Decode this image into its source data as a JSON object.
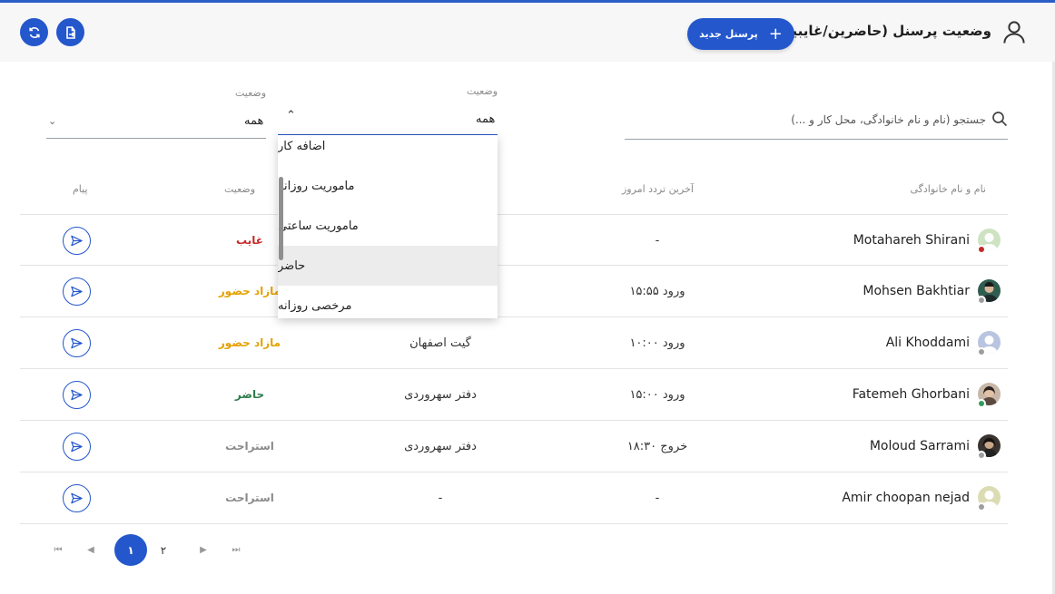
{
  "header": {
    "title": "وضعیت پرسنل (حاضرین/غایبین)",
    "new_button_label": "پرسنل جدید",
    "new_button_icon": "plus-icon",
    "accent_color": "#2457cc"
  },
  "filters": {
    "search_placeholder": "جستجو (نام و نام خانوادگی، محل کار و ...)",
    "status_filter": {
      "label": "وضعیت",
      "value": "همه"
    },
    "status_filter_2": {
      "label": "وضعیت",
      "value": "همه"
    },
    "dropdown_options": [
      "اضافه کار",
      "ماموریت روزانه",
      "ماموریت ساعتی",
      "حاضر",
      "مرخصی روزانه"
    ],
    "dropdown_highlighted": "حاضر"
  },
  "table": {
    "columns": {
      "name": "نام و نام خانوادگی",
      "last_activity": "آخرین تردد امروز",
      "status": "وضعیت",
      "message": "پیام"
    },
    "rows": [
      {
        "name": "Motahareh Shirani",
        "last": "-",
        "location": "",
        "status": "غایب",
        "status_color": "#c62828",
        "dot_color": "#c62828"
      },
      {
        "name": "Mohsen Bakhtiar",
        "last": "ورود ۱۵:۵۵",
        "location": "",
        "status": "مازاد حضور",
        "status_color": "#e5a100",
        "dot_color": "#9e9e9e"
      },
      {
        "name": "Ali Khoddami",
        "last": "ورود ۱۰:۰۰",
        "location": "گیت اصفهان",
        "status": "مازاد حضور",
        "status_color": "#e5a100",
        "dot_color": "#9e9e9e"
      },
      {
        "name": "Fatemeh Ghorbani",
        "last": "ورود ۱۵:۰۰",
        "location": "دفتر سهروردی",
        "status": "حاضر",
        "status_color": "#2e7d4f",
        "dot_color": "#2e9d5a"
      },
      {
        "name": "Moloud Sarrami",
        "last": "خروج ۱۸:۳۰",
        "location": "دفتر سهروردی",
        "status": "استراحت",
        "status_color": "#8a8a8a",
        "dot_color": "#9e9e9e"
      },
      {
        "name": "Amir choopan nejad",
        "last": "-",
        "location": "-",
        "status": "استراحت",
        "status_color": "#8a8a8a",
        "dot_color": "#9e9e9e"
      }
    ]
  },
  "pagination": {
    "pages": [
      "۱",
      "۲"
    ],
    "current": "۱"
  }
}
